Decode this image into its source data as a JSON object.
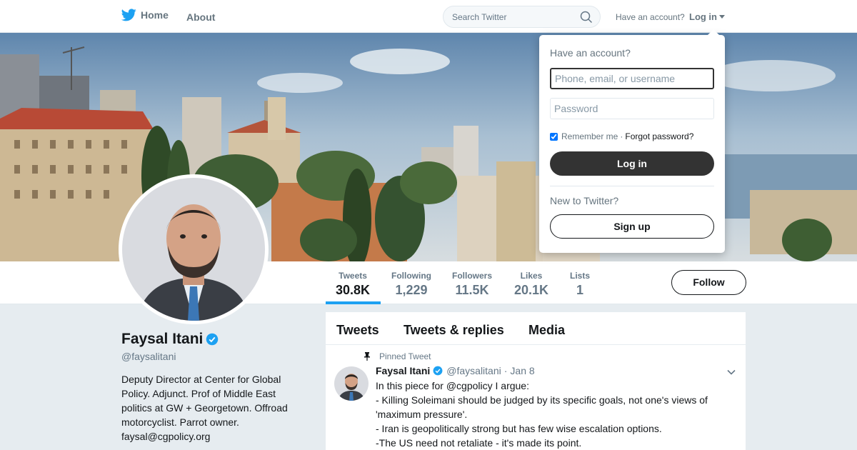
{
  "nav": {
    "home_label": "Home",
    "about_label": "About",
    "search_placeholder": "Search Twitter",
    "have_account": "Have an account?",
    "login_label": "Log in"
  },
  "profile": {
    "name": "Faysal Itani",
    "handle": "@faysalitani",
    "bio": "Deputy Director at Center for Global Policy. Adjunct. Prof of Middle East politics at GW + Georgetown. Offroad motorcyclist. Parrot owner. faysal@cgpolicy.org",
    "follow_label": "Follow"
  },
  "stats": [
    {
      "label": "Tweets",
      "value": "30.8K",
      "active": true
    },
    {
      "label": "Following",
      "value": "1,229",
      "active": false
    },
    {
      "label": "Followers",
      "value": "11.5K",
      "active": false
    },
    {
      "label": "Likes",
      "value": "20.1K",
      "active": false
    },
    {
      "label": "Lists",
      "value": "1",
      "active": false
    }
  ],
  "timeline": {
    "tabs": [
      "Tweets",
      "Tweets & replies",
      "Media"
    ],
    "pinned_label": "Pinned Tweet",
    "tweet": {
      "name": "Faysal Itani",
      "handle": "@faysalitani",
      "date": "Jan 8",
      "lines": [
        "In this piece for @cgpolicy I argue:",
        "- Killing Soleimani should be judged by its specific goals, not one's views of 'maximum pressure'.",
        "- Iran is geopolitically strong but has few wise escalation options.",
        "-The US need not retaliate - it's made its point."
      ]
    }
  },
  "login_dropdown": {
    "title": "Have an account?",
    "username_placeholder": "Phone, email, or username",
    "password_placeholder": "Password",
    "remember_label": "Remember me",
    "separator": "·",
    "forgot_label": "Forgot password?",
    "login_button": "Log in",
    "new_label": "New to Twitter?",
    "signup_button": "Sign up"
  },
  "colors": {
    "accent": "#1da1f2",
    "dark_button": "#333333",
    "background": "#e6ecf0"
  }
}
